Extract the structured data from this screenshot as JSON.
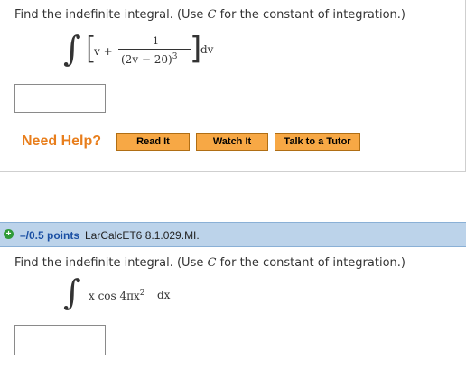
{
  "question1": {
    "prompt_pre": "Find the indefinite integral. (Use ",
    "prompt_var": "C",
    "prompt_post": " for the constant of integration.)",
    "expr": {
      "integral_symbol": "∫",
      "term": "v +",
      "numerator": "1",
      "denominator_base": "(2v − 20)",
      "denominator_exp": "3",
      "differential": "dv"
    },
    "answer_value": ""
  },
  "help": {
    "label": "Need Help?",
    "buttons": [
      "Read It",
      "Watch It",
      "Talk to a Tutor"
    ]
  },
  "question2": {
    "header": {
      "expand_icon": "plus-icon",
      "points": "–/0.5 points",
      "question_id": "LarCalcET6 8.1.029.MI."
    },
    "prompt_pre": "Find the indefinite integral. (Use ",
    "prompt_var": "C",
    "prompt_post": " for the constant of integration.)",
    "expr": {
      "integral_symbol": "∫",
      "integrand": "x cos 4πx",
      "exponent": "2",
      "differential": "dx"
    },
    "answer_value": ""
  },
  "colors": {
    "help_orange": "#e87e1c",
    "button_fill": "#f7a845",
    "header_blue": "#bcd3ea",
    "points_blue": "#1a4fa3",
    "plus_green": "#2f9b37"
  }
}
